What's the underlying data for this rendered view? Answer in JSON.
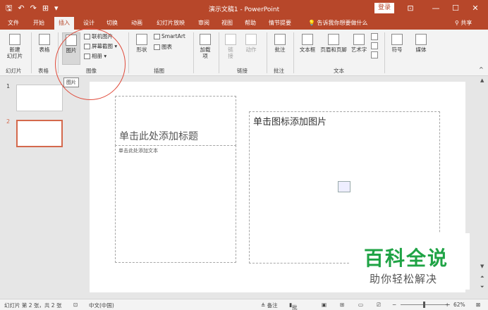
{
  "titlebar": {
    "qat": [
      "🖫",
      "↶",
      "↷",
      "⊞",
      "▾"
    ],
    "doc_title": "演示文稿1 - PowerPoint",
    "login": "登录",
    "controls": [
      "⊡",
      "—",
      "☐",
      "✕"
    ]
  },
  "tabs": [
    "文件",
    "开始",
    "插入",
    "设计",
    "切换",
    "动画",
    "幻灯片放映",
    "审阅",
    "视图",
    "帮助",
    "情节提要"
  ],
  "active_tab": "插入",
  "tell_me": "告诉我你想要做什么",
  "share": "共享",
  "ribbon": {
    "new_slide": "新建\n幻灯片",
    "table": "表格",
    "picture": "图片",
    "online_picture": "联机图片",
    "screenshot": "屏幕截图",
    "album": "相册",
    "shapes": "形状",
    "smartart": "SmartArt",
    "chart": "图表",
    "addins": "加载\n项",
    "link": "链\n接",
    "action": "动作",
    "comment": "批注",
    "textbox": "文本框",
    "header_footer": "页眉和页脚",
    "wordart": "艺术字",
    "symbol": "符号",
    "media": "媒体",
    "groups": {
      "slides": "幻灯片",
      "tables": "表格",
      "images": "图像",
      "illustrations": "插图",
      "links": "链接",
      "comments": "批注",
      "text": "文本"
    }
  },
  "tooltip": "图片",
  "thumbs": {
    "n1": "1",
    "n2": "2"
  },
  "slide": {
    "title_placeholder": "单击此处添加标题",
    "text_placeholder": "单击此处添加文本",
    "picture_placeholder": "单击图标添加图片"
  },
  "watermark": {
    "line1": "百科全说",
    "line2": "助你轻松解决"
  },
  "status": {
    "slide_info": "幻灯片 第 2 张，共 2 张",
    "lang": "中文(中国)",
    "notes": "≜ 备注",
    "comments": "批注",
    "zoom": "62%"
  }
}
